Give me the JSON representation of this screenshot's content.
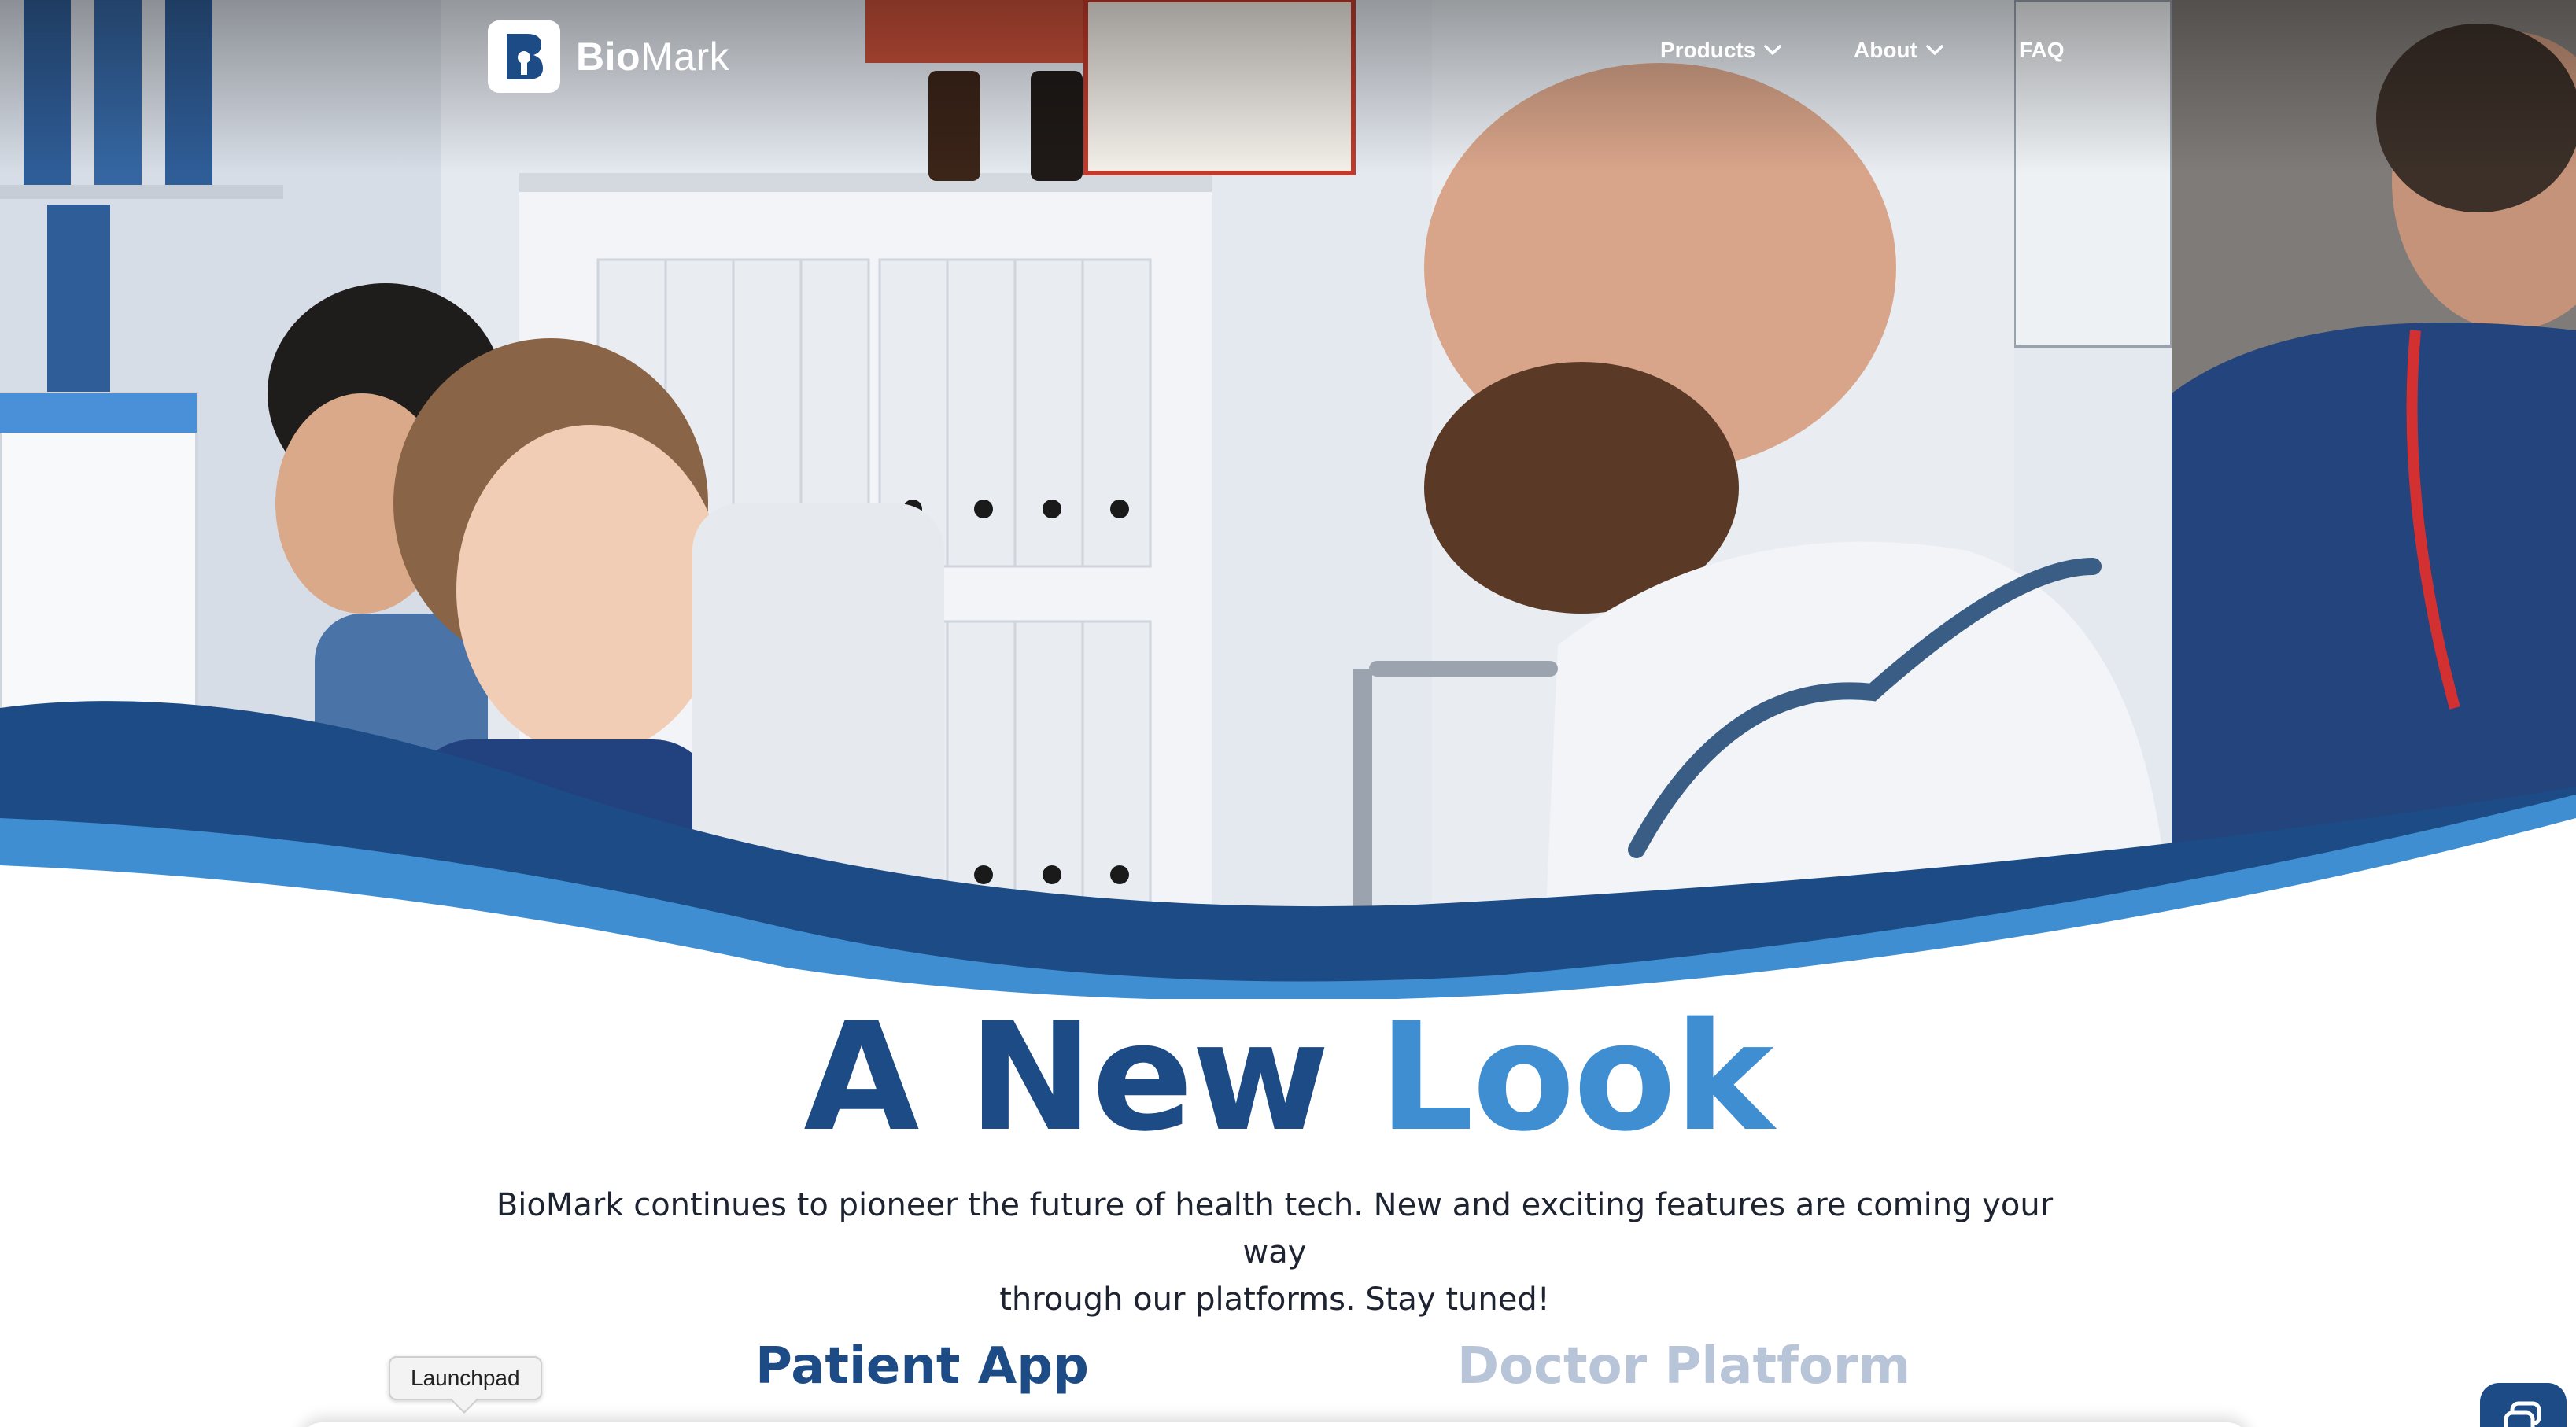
{
  "brand": {
    "name_bold": "Bio",
    "name_light": "Mark",
    "logo_letter": "B"
  },
  "nav": {
    "items": [
      {
        "label": "Products",
        "has_dropdown": true
      },
      {
        "label": "About",
        "has_dropdown": true
      },
      {
        "label": "FAQ",
        "has_dropdown": false
      }
    ]
  },
  "hero": {
    "headline_part1": "A New ",
    "headline_part2": "Look",
    "intro_line1": "BioMark continues to pioneer the future of health tech. New and exciting features are coming your way",
    "intro_line2": "through our platforms. Stay tuned!"
  },
  "platform_tabs": [
    {
      "label": "Patient App",
      "active": true
    },
    {
      "label": "Doctor Platform",
      "active": false
    }
  ],
  "tooltip": {
    "label": "Launchpad"
  },
  "colors": {
    "primary_dark": "#1c4b85",
    "primary_light": "#3f8ed2",
    "inactive_tab": "#b8c5d8",
    "body_text": "#1d2330"
  },
  "icons": {
    "nav_dropdown": "chevron-down-icon",
    "chat": "chat-icon",
    "logo": "biomark-logo-icon"
  }
}
